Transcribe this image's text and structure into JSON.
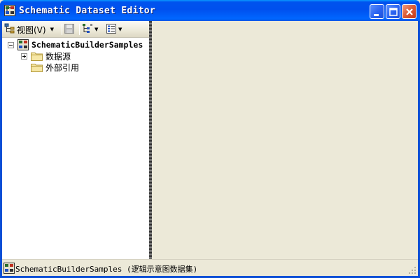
{
  "window": {
    "title": "Schematic Dataset Editor",
    "icon": "schematic-dataset-icon"
  },
  "titlebar_buttons": {
    "minimize": "minimize-icon",
    "maximize": "maximize-icon",
    "close": "close-icon"
  },
  "toolbar": {
    "view_label": "视图(V)",
    "view_icon": "view-tree-icon",
    "save_icon": "save-icon",
    "layout_icon": "layout-options-icon",
    "list_icon": "list-options-icon"
  },
  "tree": {
    "root": {
      "label": "SchematicBuilderSamples",
      "expanded": true
    },
    "children": [
      {
        "label": "数据源",
        "expandable": true,
        "icon": "folder-icon"
      },
      {
        "label": "外部引用",
        "expandable": false,
        "icon": "folder-icon"
      }
    ]
  },
  "status": {
    "text": "SchematicBuilderSamples (逻辑示意图数据集)"
  },
  "colors": {
    "titlebar": "#0054e3",
    "panel": "#ece9d8",
    "tree_bg": "#ffffff"
  }
}
